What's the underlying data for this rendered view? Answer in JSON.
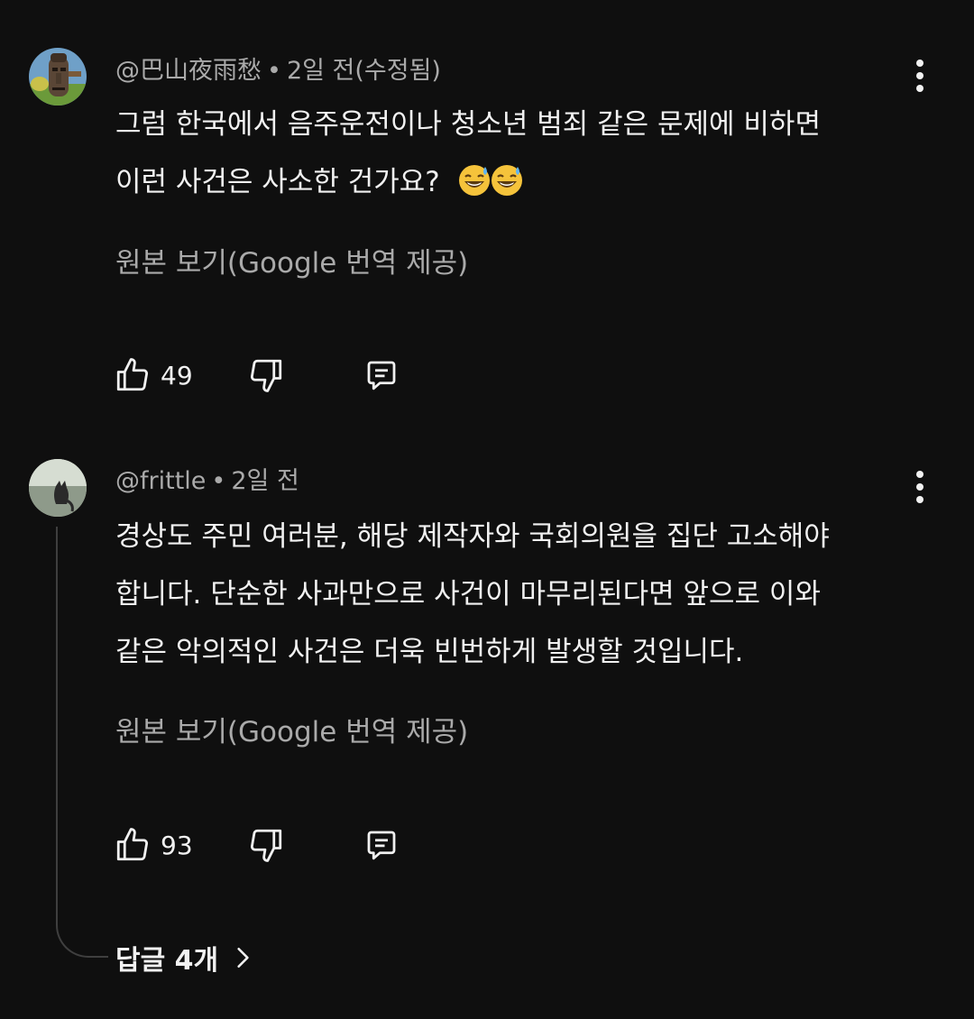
{
  "comments": [
    {
      "author": "@巴山夜雨愁",
      "separator": "•",
      "time": "2일 전(수정됨)",
      "lines": [
        "그럼 한국에서 음주운전이나 청소년 범죄 같은 문제에 비하면",
        "이런 사건은 사소한 건가요?"
      ],
      "emoji": [
        "sweat-smile-emoji",
        "sweat-smile-emoji"
      ],
      "translate_label": "원본 보기(Google 번역 제공)",
      "like_count": "49"
    },
    {
      "author": "@frittle",
      "separator": "•",
      "time": "2일 전",
      "lines": [
        "경상도 주민 여러분, 해당 제작자와 국회의원을 집단 고소해야",
        "합니다. 단순한 사과만으로 사건이 마무리된다면 앞으로 이와",
        "같은 악의적인 사건은 더욱 빈번하게 발생할 것입니다."
      ],
      "translate_label": "원본 보기(Google 번역 제공)",
      "like_count": "93",
      "replies_label": "답글 4개"
    }
  ],
  "icons": {
    "like": "thumbs-up-icon",
    "dislike": "thumbs-down-icon",
    "reply": "comment-icon",
    "more": "more-vert-icon",
    "chevron": "chevron-right-icon"
  },
  "colors": {
    "background": "#0f0f0f",
    "primary_text": "#f1f1f1",
    "secondary_text": "#aaaaaa",
    "thread_line": "#3f3f3f"
  }
}
